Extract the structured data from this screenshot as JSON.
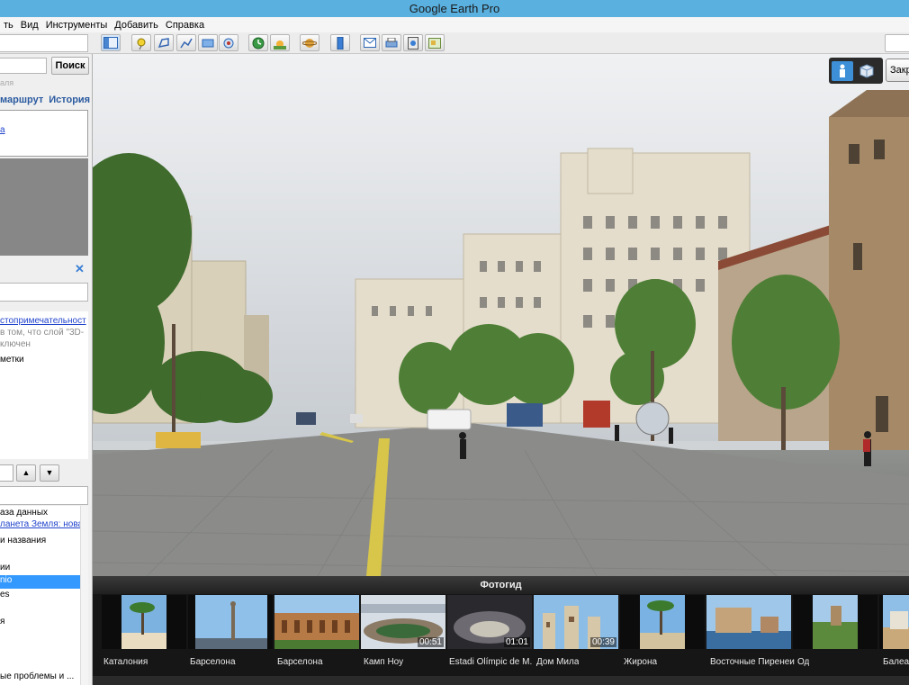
{
  "window": {
    "title": "Google Earth Pro"
  },
  "menu": [
    "ть",
    "Вид",
    "Инструменты",
    "Добавить",
    "Справка"
  ],
  "search": {
    "button_label": "Поиск",
    "hint": "аля"
  },
  "tabs": [
    "маршрут",
    "История"
  ],
  "results": {
    "link_text": "а"
  },
  "places": {
    "line1": "стопримечательност",
    "line2": "в том, что слой \"3D-",
    "line3": "ключен",
    "line4": "метки"
  },
  "layers": {
    "items": [
      "аза данных",
      "ланета Земля: нова",
      "и названия",
      "ии",
      "nio",
      "es",
      "я",
      "ые проблемы и ..."
    ],
    "selected_index": 4
  },
  "nav": {
    "close_label": "Закрыть"
  },
  "photoguide": {
    "title": "Фотогид",
    "items": [
      {
        "caption": "Каталония",
        "duration": ""
      },
      {
        "caption": "Барселона",
        "duration": ""
      },
      {
        "caption": "Барселона",
        "duration": ""
      },
      {
        "caption": "Камп Ноу",
        "duration": "00:51"
      },
      {
        "caption": "Estadi Olímpic de M...",
        "duration": "01:01"
      },
      {
        "caption": "Дом Мила",
        "duration": "00:39"
      },
      {
        "caption": "Жирона",
        "duration": ""
      },
      {
        "caption": "Восточные Пиренеи",
        "duration": ""
      },
      {
        "caption": "Од",
        "duration": ""
      },
      {
        "caption": "Балеар",
        "duration": ""
      }
    ]
  },
  "colors": {
    "titlebar": "#5ab0df",
    "selection": "#3399ff",
    "link": "#2244cc"
  }
}
